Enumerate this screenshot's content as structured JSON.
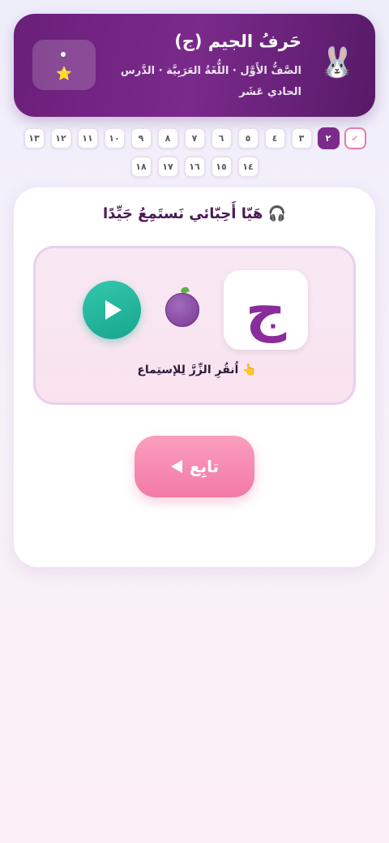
{
  "header": {
    "title": "حَرفُ الجيم (ج)",
    "subtitle": "الصَّفُّ الأَوَّل · اللُّغَةُ العَرَبِيَّة · الدَّرس الحادي عَشَر",
    "mascot_emoji": "🐰",
    "badge_star": "⭐"
  },
  "steps": {
    "items": [
      {
        "label": "✓",
        "state": "done"
      },
      {
        "label": "٢",
        "state": "current"
      },
      {
        "label": "٣",
        "state": "todo"
      },
      {
        "label": "٤",
        "state": "todo"
      },
      {
        "label": "٥",
        "state": "todo"
      },
      {
        "label": "٦",
        "state": "todo"
      },
      {
        "label": "٧",
        "state": "todo"
      },
      {
        "label": "٨",
        "state": "todo"
      },
      {
        "label": "٩",
        "state": "todo"
      },
      {
        "label": "١٠",
        "state": "todo"
      },
      {
        "label": "١١",
        "state": "todo"
      },
      {
        "label": "١٢",
        "state": "todo"
      },
      {
        "label": "١٣",
        "state": "todo"
      },
      {
        "label": "١٤",
        "state": "todo"
      },
      {
        "label": "١٥",
        "state": "todo"
      },
      {
        "label": "١٦",
        "state": "todo"
      },
      {
        "label": "١٧",
        "state": "todo"
      },
      {
        "label": "١٨",
        "state": "todo"
      }
    ]
  },
  "card": {
    "title": "🎧 هَيّا أَحِبّائي نَستَمِعُ جَيِّدًا",
    "letter": "ج",
    "tap_hint": "👆 اُنقُرِ الزِّرَّ لِلإستِماع",
    "continue_label": "تابِع"
  },
  "colors": {
    "header_bg": "#6a1f7a",
    "accent_pink": "#f27aa6",
    "accent_teal": "#17a58d",
    "letter_purple": "#8a2c9c"
  }
}
